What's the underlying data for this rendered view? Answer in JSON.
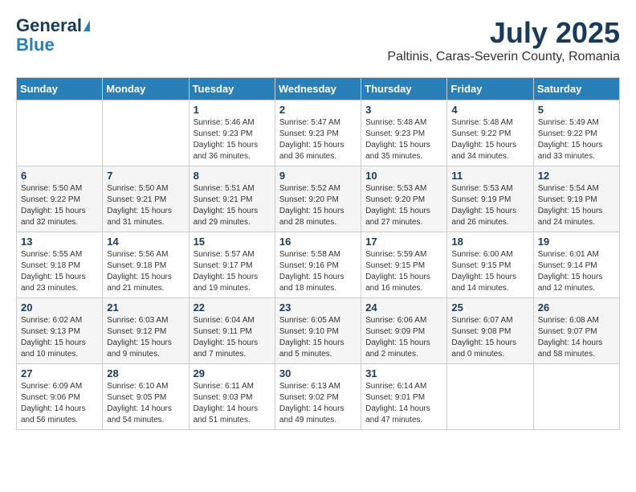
{
  "logo": {
    "line1": "General",
    "line2": "Blue"
  },
  "header": {
    "title": "July 2025",
    "subtitle": "Paltinis, Caras-Severin County, Romania"
  },
  "weekdays": [
    "Sunday",
    "Monday",
    "Tuesday",
    "Wednesday",
    "Thursday",
    "Friday",
    "Saturday"
  ],
  "weeks": [
    [
      {
        "day": "",
        "info": ""
      },
      {
        "day": "",
        "info": ""
      },
      {
        "day": "1",
        "info": "Sunrise: 5:46 AM\nSunset: 9:23 PM\nDaylight: 15 hours and 36 minutes."
      },
      {
        "day": "2",
        "info": "Sunrise: 5:47 AM\nSunset: 9:23 PM\nDaylight: 15 hours and 36 minutes."
      },
      {
        "day": "3",
        "info": "Sunrise: 5:48 AM\nSunset: 9:23 PM\nDaylight: 15 hours and 35 minutes."
      },
      {
        "day": "4",
        "info": "Sunrise: 5:48 AM\nSunset: 9:22 PM\nDaylight: 15 hours and 34 minutes."
      },
      {
        "day": "5",
        "info": "Sunrise: 5:49 AM\nSunset: 9:22 PM\nDaylight: 15 hours and 33 minutes."
      }
    ],
    [
      {
        "day": "6",
        "info": "Sunrise: 5:50 AM\nSunset: 9:22 PM\nDaylight: 15 hours and 32 minutes."
      },
      {
        "day": "7",
        "info": "Sunrise: 5:50 AM\nSunset: 9:21 PM\nDaylight: 15 hours and 31 minutes."
      },
      {
        "day": "8",
        "info": "Sunrise: 5:51 AM\nSunset: 9:21 PM\nDaylight: 15 hours and 29 minutes."
      },
      {
        "day": "9",
        "info": "Sunrise: 5:52 AM\nSunset: 9:20 PM\nDaylight: 15 hours and 28 minutes."
      },
      {
        "day": "10",
        "info": "Sunrise: 5:53 AM\nSunset: 9:20 PM\nDaylight: 15 hours and 27 minutes."
      },
      {
        "day": "11",
        "info": "Sunrise: 5:53 AM\nSunset: 9:19 PM\nDaylight: 15 hours and 26 minutes."
      },
      {
        "day": "12",
        "info": "Sunrise: 5:54 AM\nSunset: 9:19 PM\nDaylight: 15 hours and 24 minutes."
      }
    ],
    [
      {
        "day": "13",
        "info": "Sunrise: 5:55 AM\nSunset: 9:18 PM\nDaylight: 15 hours and 23 minutes."
      },
      {
        "day": "14",
        "info": "Sunrise: 5:56 AM\nSunset: 9:18 PM\nDaylight: 15 hours and 21 minutes."
      },
      {
        "day": "15",
        "info": "Sunrise: 5:57 AM\nSunset: 9:17 PM\nDaylight: 15 hours and 19 minutes."
      },
      {
        "day": "16",
        "info": "Sunrise: 5:58 AM\nSunset: 9:16 PM\nDaylight: 15 hours and 18 minutes."
      },
      {
        "day": "17",
        "info": "Sunrise: 5:59 AM\nSunset: 9:15 PM\nDaylight: 15 hours and 16 minutes."
      },
      {
        "day": "18",
        "info": "Sunrise: 6:00 AM\nSunset: 9:15 PM\nDaylight: 15 hours and 14 minutes."
      },
      {
        "day": "19",
        "info": "Sunrise: 6:01 AM\nSunset: 9:14 PM\nDaylight: 15 hours and 12 minutes."
      }
    ],
    [
      {
        "day": "20",
        "info": "Sunrise: 6:02 AM\nSunset: 9:13 PM\nDaylight: 15 hours and 10 minutes."
      },
      {
        "day": "21",
        "info": "Sunrise: 6:03 AM\nSunset: 9:12 PM\nDaylight: 15 hours and 9 minutes."
      },
      {
        "day": "22",
        "info": "Sunrise: 6:04 AM\nSunset: 9:11 PM\nDaylight: 15 hours and 7 minutes."
      },
      {
        "day": "23",
        "info": "Sunrise: 6:05 AM\nSunset: 9:10 PM\nDaylight: 15 hours and 5 minutes."
      },
      {
        "day": "24",
        "info": "Sunrise: 6:06 AM\nSunset: 9:09 PM\nDaylight: 15 hours and 2 minutes."
      },
      {
        "day": "25",
        "info": "Sunrise: 6:07 AM\nSunset: 9:08 PM\nDaylight: 15 hours and 0 minutes."
      },
      {
        "day": "26",
        "info": "Sunrise: 6:08 AM\nSunset: 9:07 PM\nDaylight: 14 hours and 58 minutes."
      }
    ],
    [
      {
        "day": "27",
        "info": "Sunrise: 6:09 AM\nSunset: 9:06 PM\nDaylight: 14 hours and 56 minutes."
      },
      {
        "day": "28",
        "info": "Sunrise: 6:10 AM\nSunset: 9:05 PM\nDaylight: 14 hours and 54 minutes."
      },
      {
        "day": "29",
        "info": "Sunrise: 6:11 AM\nSunset: 9:03 PM\nDaylight: 14 hours and 51 minutes."
      },
      {
        "day": "30",
        "info": "Sunrise: 6:13 AM\nSunset: 9:02 PM\nDaylight: 14 hours and 49 minutes."
      },
      {
        "day": "31",
        "info": "Sunrise: 6:14 AM\nSunset: 9:01 PM\nDaylight: 14 hours and 47 minutes."
      },
      {
        "day": "",
        "info": ""
      },
      {
        "day": "",
        "info": ""
      }
    ]
  ]
}
